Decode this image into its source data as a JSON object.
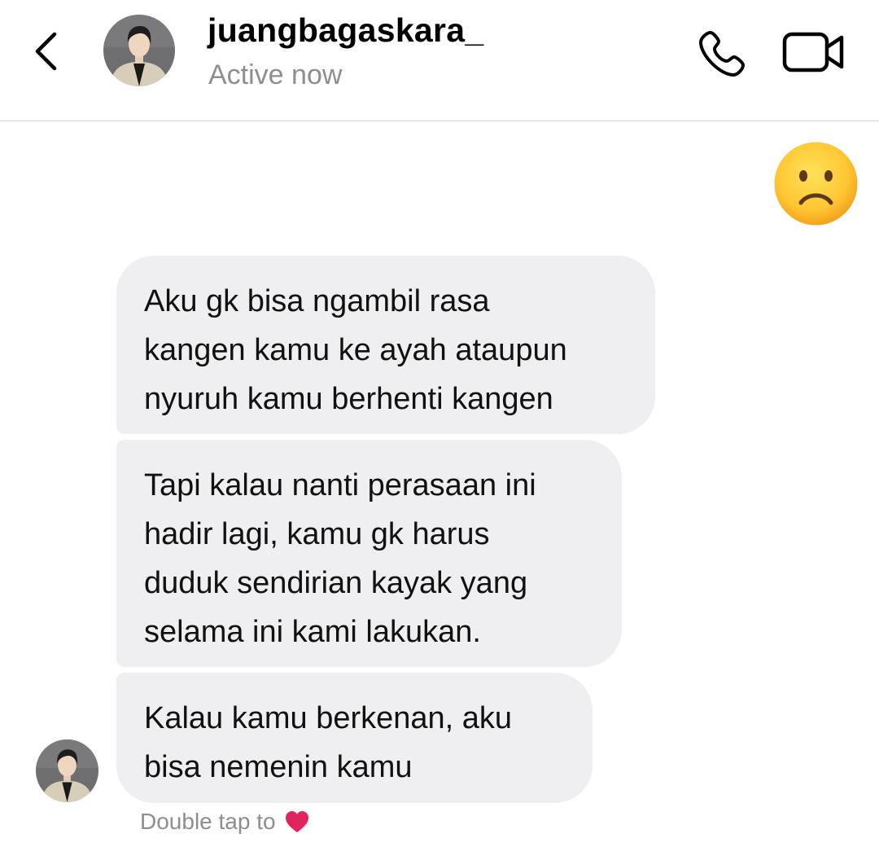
{
  "header": {
    "username": "juangbagaskara_",
    "status": "Active now",
    "back_icon": "chevron-left-icon",
    "call_icon": "phone-icon",
    "video_icon": "video-camera-icon"
  },
  "messages": [
    {
      "type": "emoji",
      "from": "me",
      "emoji": "frowning-face"
    },
    {
      "type": "text",
      "from": "them",
      "lines": [
        "Aku gk bisa ngambil rasa",
        "kangen kamu ke ayah ataupun",
        "nyuruh kamu berhenti kangen"
      ]
    },
    {
      "type": "text",
      "from": "them",
      "lines": [
        "Tapi kalau nanti perasaan ini",
        "hadir lagi, kamu gk harus",
        "duduk sendirian kayak yang",
        "selama ini kami lakukan."
      ]
    },
    {
      "type": "text",
      "from": "them",
      "lines": [
        "Kalau kamu berkenan, aku",
        "bisa nemenin kamu"
      ]
    }
  ],
  "hint": {
    "text": "Double tap to",
    "icon": "heart-icon"
  },
  "colors": {
    "bubble": "#efeff1",
    "secondary_text": "#8e8e8e",
    "divider": "#d4d4d4",
    "heart": "#e0245e"
  }
}
